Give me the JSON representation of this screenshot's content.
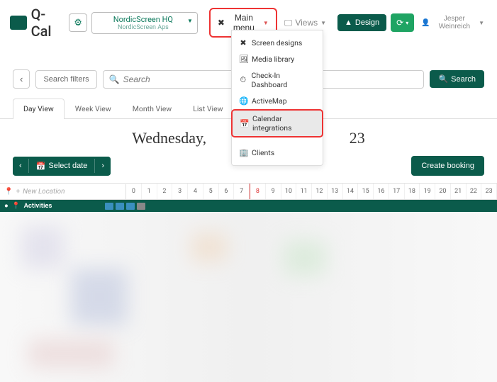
{
  "brand": "Q-Cal",
  "location": {
    "line1": "NordicScreen HQ",
    "line2": "NordicScreen Aps"
  },
  "main_menu_label": "Main menu",
  "views_label": "Views",
  "design_label": "Design",
  "user_name": "Jesper Weinreich",
  "dropdown": {
    "screen_designs": "Screen designs",
    "media_library": "Media library",
    "checkin": "Check-In Dashboard",
    "activemap": "ActiveMap",
    "calendar_integrations": "Calendar integrations",
    "clients": "Clients"
  },
  "search": {
    "filters": "Search filters",
    "placeholder": "Search",
    "button": "Search"
  },
  "tabs": {
    "day": "Day View",
    "week": "Week View",
    "month": "Month View",
    "list": "List View"
  },
  "date_heading_prefix": "Wednesday,",
  "date_heading_suffix": "23",
  "select_date": "Select date",
  "create_booking": "Create booking",
  "new_location": "New Location",
  "activities_label": "Activities",
  "hours": [
    "0",
    "1",
    "2",
    "3",
    "4",
    "5",
    "6",
    "7",
    "8",
    "9",
    "10",
    "11",
    "12",
    "13",
    "14",
    "15",
    "16",
    "17",
    "18",
    "19",
    "20",
    "21",
    "22",
    "23"
  ],
  "current_hour_index": 8
}
